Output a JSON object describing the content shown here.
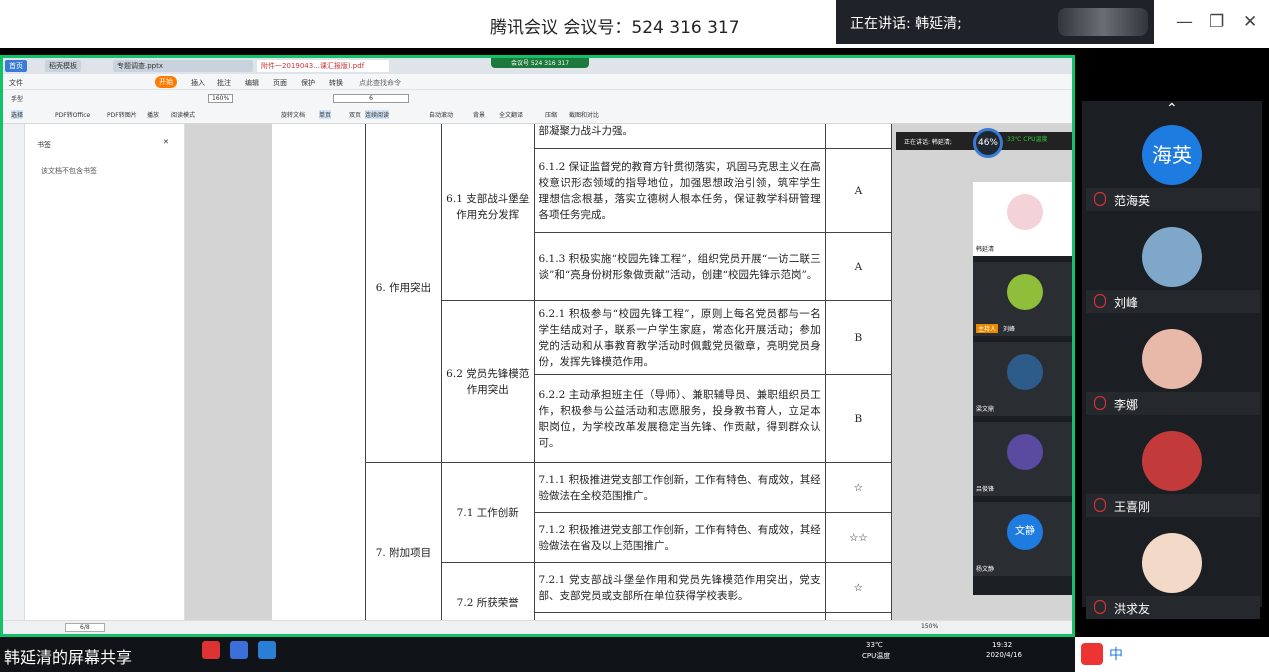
{
  "meeting": {
    "title": "腾讯会议 会议号：524 316 317",
    "speaking": "正在讲话: 韩延清;",
    "presenter_label": "韩延清的屏幕共享"
  },
  "wps": {
    "tabs": [
      "首页",
      "稻壳模板",
      "专题调查.pptx",
      "附件一2019043...课汇报版).pdf"
    ],
    "chip": "会议号 524 316 317",
    "menu": [
      "文件",
      "开始",
      "插入",
      "批注",
      "编辑",
      "页面",
      "保护",
      "转换"
    ],
    "search": "点此查找命令",
    "tools": [
      "手型",
      "选择",
      "PDF转Office",
      "PDF转图片",
      "播放",
      "阅读模式",
      "旋转文档",
      "单页",
      "双页",
      "连续阅读",
      "自动滚动",
      "背景",
      "全文翻译",
      "压缩",
      "截图和对比"
    ],
    "zoom": "160%",
    "page_box": "6",
    "bookmark_title": "书签",
    "bookmark_empty": "该文档不包含书签",
    "page_status": "6/8",
    "status_zoom": "150%"
  },
  "doc": {
    "rows": [
      {
        "c3": "部凝聚力战斗力强。",
        "c4": ""
      },
      {
        "c3": "6.1.2 保证监督党的教育方针贯彻落实，巩固马克思主义在高校意识形态领域的指导地位，加强思想政治引领，筑牢学生理想信念根基，落实立德树人根本任务，保证教学科研管理各项任务完成。",
        "c4": "A"
      },
      {
        "c3": "6.1.3 积极实施“校园先锋工程”，组织党员开展“一访二联三谈”和“亮身份树形象做贡献”活动，创建“校园先锋示范岗”。",
        "c4": "A"
      },
      {
        "c3": "6.2.1 积极参与“校园先锋工程”，原则上每名党员都与一名学生结成对子，联系一户学生家庭，常态化开展活动；参加党的活动和从事教育教学活动时佩戴党员徽章，亮明党员身份，发挥先锋模范作用。",
        "c4": "B"
      },
      {
        "c3": "6.2.2 主动承担班主任（导师）、兼职辅导员、兼职组织员工作，积极参与公益活动和志愿服务，投身教书育人，立足本职岗位，为学校改革发展稳定当先锋、作贡献，得到群众认可。",
        "c4": "B"
      },
      {
        "c3": "7.1.1 积极推进党支部工作创新，工作有特色、有成效，其经验做法在全校范围推广。",
        "c4": "☆"
      },
      {
        "c3": "7.1.2 积极推进党支部工作创新，工作有特色、有成效，其经验做法在省及以上范围推广。",
        "c4": "☆☆"
      },
      {
        "c3": "7.2.1 党支部战斗堡垒作用和党员先锋模范作用突出，党支部、支部党员或支部所在单位获得学校表彰。",
        "c4": "☆"
      },
      {
        "c3": "",
        "c4": ""
      }
    ],
    "c1": [
      "6. 作用突出",
      "7. 附加项目"
    ],
    "c2": [
      "6.1 支部战斗堡垒作用充分发挥",
      "6.2 党员先锋模范作用突出",
      "7.1 工作创新",
      "7.2 所获荣誉"
    ]
  },
  "mini": {
    "banner": "正在讲话: 韩延清;",
    "gauge": "46%",
    "cpu": "33℃ CPU温度",
    "names": [
      "韩延清",
      "刘峰",
      "梁文鼎",
      "吕俊锋",
      "杨文静"
    ],
    "host_tag": "主持人",
    "avatar_text": "文静"
  },
  "participants": [
    {
      "name": "范海英",
      "avatar": "海英"
    },
    {
      "name": "刘峰"
    },
    {
      "name": "李娜"
    },
    {
      "name": "王喜刚"
    },
    {
      "name": "洪求友"
    }
  ],
  "taskbar": {
    "time": "19:32",
    "date": "2020/4/16",
    "temp": "33℃",
    "temp_label": "CPU温度",
    "ime": "中"
  }
}
